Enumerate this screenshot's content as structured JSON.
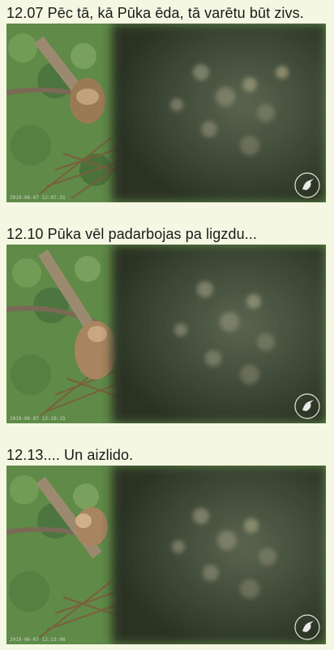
{
  "posts": [
    {
      "caption": "12.07 Pēc tā, kā Pūka ēda, tā varētu būt zivs.",
      "timestamp": "2019-06-07 12:07:31"
    },
    {
      "caption": "12.10 Pūka vēl padarbojas pa ligzdu...",
      "timestamp": "2019-06-07 12:10:15"
    },
    {
      "caption": "12.13.... Un aizlido.",
      "timestamp": "2019-06-07 12:13:06"
    }
  ],
  "colors": {
    "background": "#f4f7e2",
    "text": "#1a1a1a",
    "foliage": "#4f7a3a",
    "blur_overlay": "#3c4a32"
  },
  "icons": {
    "watermark": "kingfisher-logo-icon"
  }
}
